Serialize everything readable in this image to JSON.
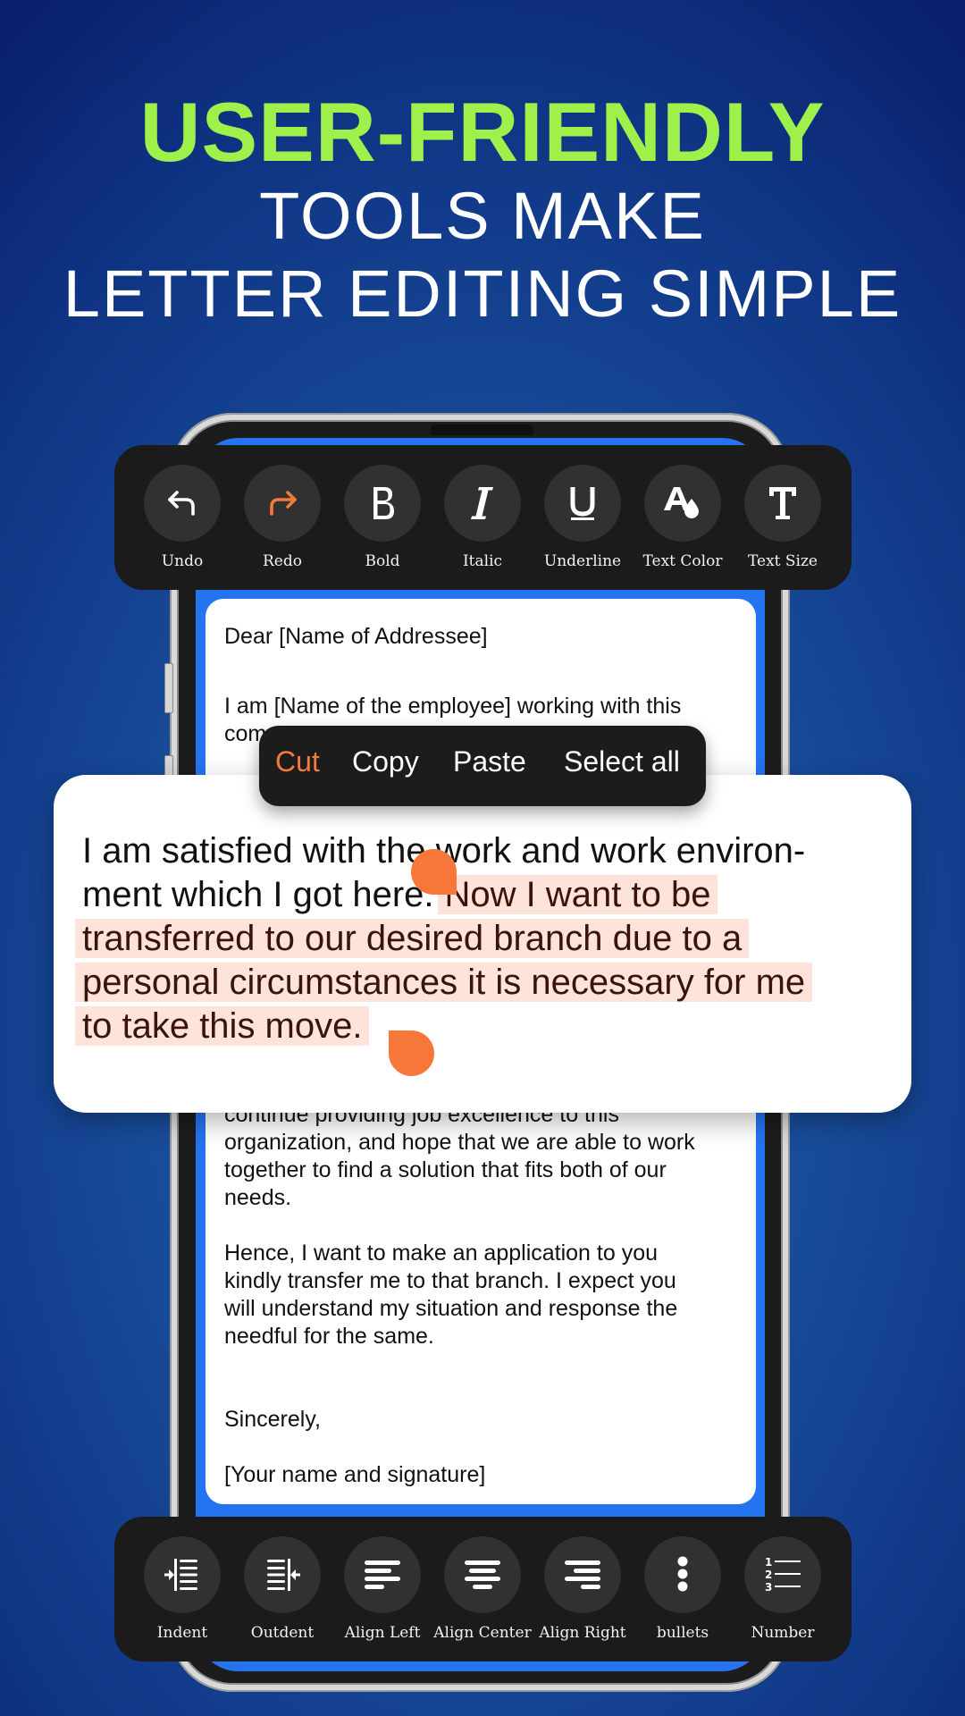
{
  "headline": {
    "line1": "USER-FRIENDLY",
    "line2": "TOOLS MAKE",
    "line3": "LETTER EDITING SIMPLE"
  },
  "colors": {
    "accent_green": "#9ef04a",
    "accent_orange": "#f47a3c",
    "selection_bg": "#fde3da",
    "screen_blue": "#2474f0",
    "toolbar_bg": "#1b1b1b"
  },
  "top_toolbar": [
    {
      "label": "Undo",
      "icon": "undo-icon"
    },
    {
      "label": "Redo",
      "icon": "redo-icon",
      "active": true
    },
    {
      "label": "Bold",
      "icon": "bold-icon"
    },
    {
      "label": "Italic",
      "icon": "italic-icon"
    },
    {
      "label": "Underline",
      "icon": "underline-icon"
    },
    {
      "label": "Text Color",
      "icon": "text-color-icon"
    },
    {
      "label": "Text Size",
      "icon": "text-size-icon"
    }
  ],
  "bottom_toolbar": [
    {
      "label": "Indent",
      "icon": "indent-icon"
    },
    {
      "label": "Outdent",
      "icon": "outdent-icon"
    },
    {
      "label": "Align Left",
      "icon": "align-left-icon"
    },
    {
      "label": "Align Center",
      "icon": "align-center-icon"
    },
    {
      "label": "Align Right",
      "icon": "align-right-icon"
    },
    {
      "label": "bullets",
      "icon": "bullets-icon"
    },
    {
      "label": "Number",
      "icon": "numbered-list-icon"
    }
  ],
  "context_menu": {
    "items": [
      "Cut",
      "Copy",
      "Paste",
      "Select all"
    ],
    "active": "Cut"
  },
  "document": {
    "lines_top": [
      "Dear [Name of Addressee]",
      "I am [Name of the employee] working with this",
      "com"
    ],
    "lines_bottom": [
      "continue providing job excellence to this",
      "organization, and hope that we are able to work",
      "together to find a solution that fits both of our",
      "needs.",
      "Hence, I want to make an application to you",
      "kindly transfer me to that branch. I expect you",
      "will understand my situation and response the",
      "needful for the same.",
      "Sincerely,",
      "[Your name and signature]"
    ]
  },
  "zoom_card": {
    "line1": "I am satisfied with the work and work environ-",
    "line2_plain": "ment which I got here.",
    "line2_selected": "Now I want to be",
    "line3_selected": "transferred to our desired branch due to a",
    "line4_selected": "personal circumstances it is necessary for me",
    "line5_selected": "to take this move."
  }
}
